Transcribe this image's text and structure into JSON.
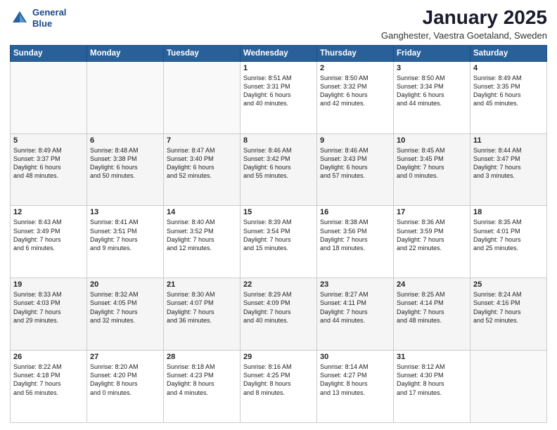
{
  "header": {
    "logo_line1": "General",
    "logo_line2": "Blue",
    "month_title": "January 2025",
    "location": "Ganghester, Vaestra Goetaland, Sweden"
  },
  "weekdays": [
    "Sunday",
    "Monday",
    "Tuesday",
    "Wednesday",
    "Thursday",
    "Friday",
    "Saturday"
  ],
  "weeks": [
    [
      {
        "day": "",
        "content": ""
      },
      {
        "day": "",
        "content": ""
      },
      {
        "day": "",
        "content": ""
      },
      {
        "day": "1",
        "content": "Sunrise: 8:51 AM\nSunset: 3:31 PM\nDaylight: 6 hours\nand 40 minutes."
      },
      {
        "day": "2",
        "content": "Sunrise: 8:50 AM\nSunset: 3:32 PM\nDaylight: 6 hours\nand 42 minutes."
      },
      {
        "day": "3",
        "content": "Sunrise: 8:50 AM\nSunset: 3:34 PM\nDaylight: 6 hours\nand 44 minutes."
      },
      {
        "day": "4",
        "content": "Sunrise: 8:49 AM\nSunset: 3:35 PM\nDaylight: 6 hours\nand 45 minutes."
      }
    ],
    [
      {
        "day": "5",
        "content": "Sunrise: 8:49 AM\nSunset: 3:37 PM\nDaylight: 6 hours\nand 48 minutes."
      },
      {
        "day": "6",
        "content": "Sunrise: 8:48 AM\nSunset: 3:38 PM\nDaylight: 6 hours\nand 50 minutes."
      },
      {
        "day": "7",
        "content": "Sunrise: 8:47 AM\nSunset: 3:40 PM\nDaylight: 6 hours\nand 52 minutes."
      },
      {
        "day": "8",
        "content": "Sunrise: 8:46 AM\nSunset: 3:42 PM\nDaylight: 6 hours\nand 55 minutes."
      },
      {
        "day": "9",
        "content": "Sunrise: 8:46 AM\nSunset: 3:43 PM\nDaylight: 6 hours\nand 57 minutes."
      },
      {
        "day": "10",
        "content": "Sunrise: 8:45 AM\nSunset: 3:45 PM\nDaylight: 7 hours\nand 0 minutes."
      },
      {
        "day": "11",
        "content": "Sunrise: 8:44 AM\nSunset: 3:47 PM\nDaylight: 7 hours\nand 3 minutes."
      }
    ],
    [
      {
        "day": "12",
        "content": "Sunrise: 8:43 AM\nSunset: 3:49 PM\nDaylight: 7 hours\nand 6 minutes."
      },
      {
        "day": "13",
        "content": "Sunrise: 8:41 AM\nSunset: 3:51 PM\nDaylight: 7 hours\nand 9 minutes."
      },
      {
        "day": "14",
        "content": "Sunrise: 8:40 AM\nSunset: 3:52 PM\nDaylight: 7 hours\nand 12 minutes."
      },
      {
        "day": "15",
        "content": "Sunrise: 8:39 AM\nSunset: 3:54 PM\nDaylight: 7 hours\nand 15 minutes."
      },
      {
        "day": "16",
        "content": "Sunrise: 8:38 AM\nSunset: 3:56 PM\nDaylight: 7 hours\nand 18 minutes."
      },
      {
        "day": "17",
        "content": "Sunrise: 8:36 AM\nSunset: 3:59 PM\nDaylight: 7 hours\nand 22 minutes."
      },
      {
        "day": "18",
        "content": "Sunrise: 8:35 AM\nSunset: 4:01 PM\nDaylight: 7 hours\nand 25 minutes."
      }
    ],
    [
      {
        "day": "19",
        "content": "Sunrise: 8:33 AM\nSunset: 4:03 PM\nDaylight: 7 hours\nand 29 minutes."
      },
      {
        "day": "20",
        "content": "Sunrise: 8:32 AM\nSunset: 4:05 PM\nDaylight: 7 hours\nand 32 minutes."
      },
      {
        "day": "21",
        "content": "Sunrise: 8:30 AM\nSunset: 4:07 PM\nDaylight: 7 hours\nand 36 minutes."
      },
      {
        "day": "22",
        "content": "Sunrise: 8:29 AM\nSunset: 4:09 PM\nDaylight: 7 hours\nand 40 minutes."
      },
      {
        "day": "23",
        "content": "Sunrise: 8:27 AM\nSunset: 4:11 PM\nDaylight: 7 hours\nand 44 minutes."
      },
      {
        "day": "24",
        "content": "Sunrise: 8:25 AM\nSunset: 4:14 PM\nDaylight: 7 hours\nand 48 minutes."
      },
      {
        "day": "25",
        "content": "Sunrise: 8:24 AM\nSunset: 4:16 PM\nDaylight: 7 hours\nand 52 minutes."
      }
    ],
    [
      {
        "day": "26",
        "content": "Sunrise: 8:22 AM\nSunset: 4:18 PM\nDaylight: 7 hours\nand 56 minutes."
      },
      {
        "day": "27",
        "content": "Sunrise: 8:20 AM\nSunset: 4:20 PM\nDaylight: 8 hours\nand 0 minutes."
      },
      {
        "day": "28",
        "content": "Sunrise: 8:18 AM\nSunset: 4:23 PM\nDaylight: 8 hours\nand 4 minutes."
      },
      {
        "day": "29",
        "content": "Sunrise: 8:16 AM\nSunset: 4:25 PM\nDaylight: 8 hours\nand 8 minutes."
      },
      {
        "day": "30",
        "content": "Sunrise: 8:14 AM\nSunset: 4:27 PM\nDaylight: 8 hours\nand 13 minutes."
      },
      {
        "day": "31",
        "content": "Sunrise: 8:12 AM\nSunset: 4:30 PM\nDaylight: 8 hours\nand 17 minutes."
      },
      {
        "day": "",
        "content": ""
      }
    ]
  ]
}
